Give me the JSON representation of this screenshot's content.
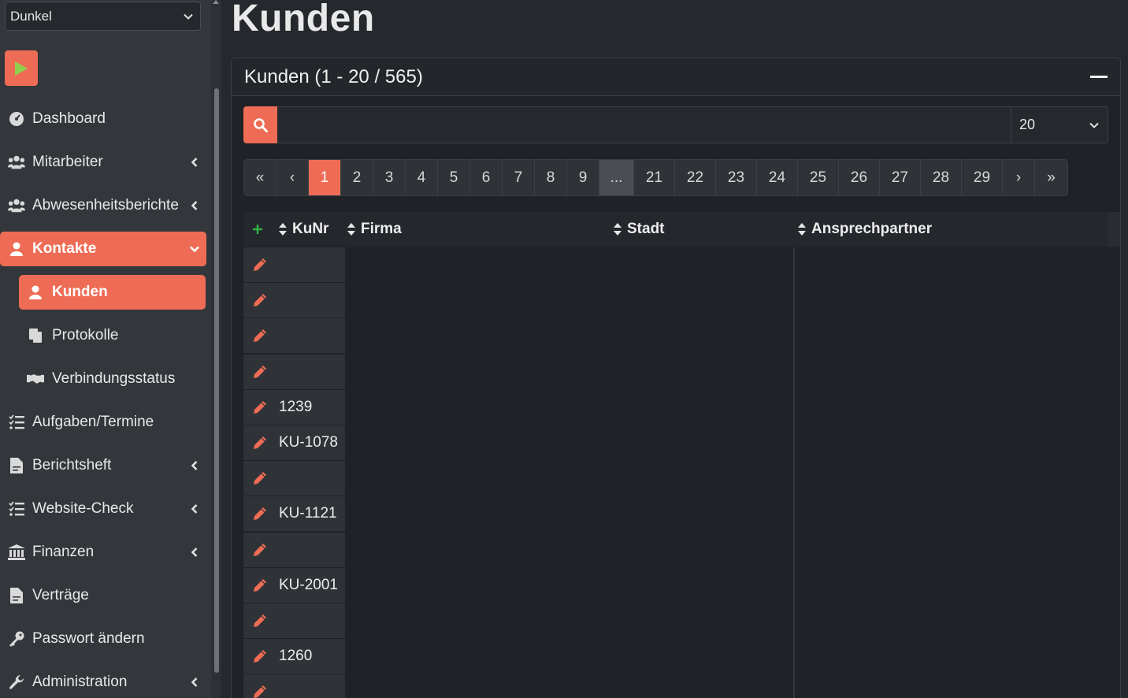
{
  "sidebar": {
    "theme": "Dunkel",
    "items": [
      {
        "label": "Dashboard",
        "icon": "dashboard-icon",
        "chevron": ""
      },
      {
        "label": "Mitarbeiter",
        "icon": "users-icon",
        "chevron": "left"
      },
      {
        "label": "Abwesenheitsberichte",
        "icon": "users-icon",
        "chevron": "left"
      },
      {
        "label": "Kontakte",
        "icon": "contact-icon",
        "chevron": "down"
      },
      {
        "label": "Kunden",
        "icon": "contact-icon",
        "chevron": ""
      },
      {
        "label": "Protokolle",
        "icon": "copy-icon",
        "chevron": ""
      },
      {
        "label": "Verbindungsstatus",
        "icon": "handshake-icon",
        "chevron": ""
      },
      {
        "label": "Aufgaben/Termine",
        "icon": "tasks-icon",
        "chevron": ""
      },
      {
        "label": "Berichtsheft",
        "icon": "file-icon",
        "chevron": "left"
      },
      {
        "label": "Website-Check",
        "icon": "tasks-icon",
        "chevron": "left"
      },
      {
        "label": "Finanzen",
        "icon": "bank-icon",
        "chevron": "left"
      },
      {
        "label": "Verträge",
        "icon": "file-icon",
        "chevron": ""
      },
      {
        "label": "Passwort ändern",
        "icon": "key-icon",
        "chevron": ""
      },
      {
        "label": "Administration",
        "icon": "wrench-icon",
        "chevron": "left"
      }
    ]
  },
  "page": {
    "title": "Kunden",
    "card_title": "Kunden (1 - 20 / 565)"
  },
  "search": {
    "placeholder": "",
    "page_size": "20"
  },
  "pagination": [
    "«",
    "‹",
    "1",
    "2",
    "3",
    "4",
    "5",
    "6",
    "7",
    "8",
    "9",
    "...",
    "21",
    "22",
    "23",
    "24",
    "25",
    "26",
    "27",
    "28",
    "29",
    "›",
    "»"
  ],
  "pagination_active": "1",
  "table": {
    "columns": [
      "KuNr",
      "Firma",
      "Stadt",
      "Ansprechpartner"
    ],
    "rows": [
      "",
      "",
      "",
      "",
      "1239",
      "KU-1078",
      "",
      "KU-1121",
      "",
      "KU-2001",
      "",
      "1260",
      ""
    ]
  },
  "colors": {
    "accent": "#ee6c55",
    "add": "#2fb344",
    "sidebar": "#33373c",
    "background": "#25282c"
  }
}
